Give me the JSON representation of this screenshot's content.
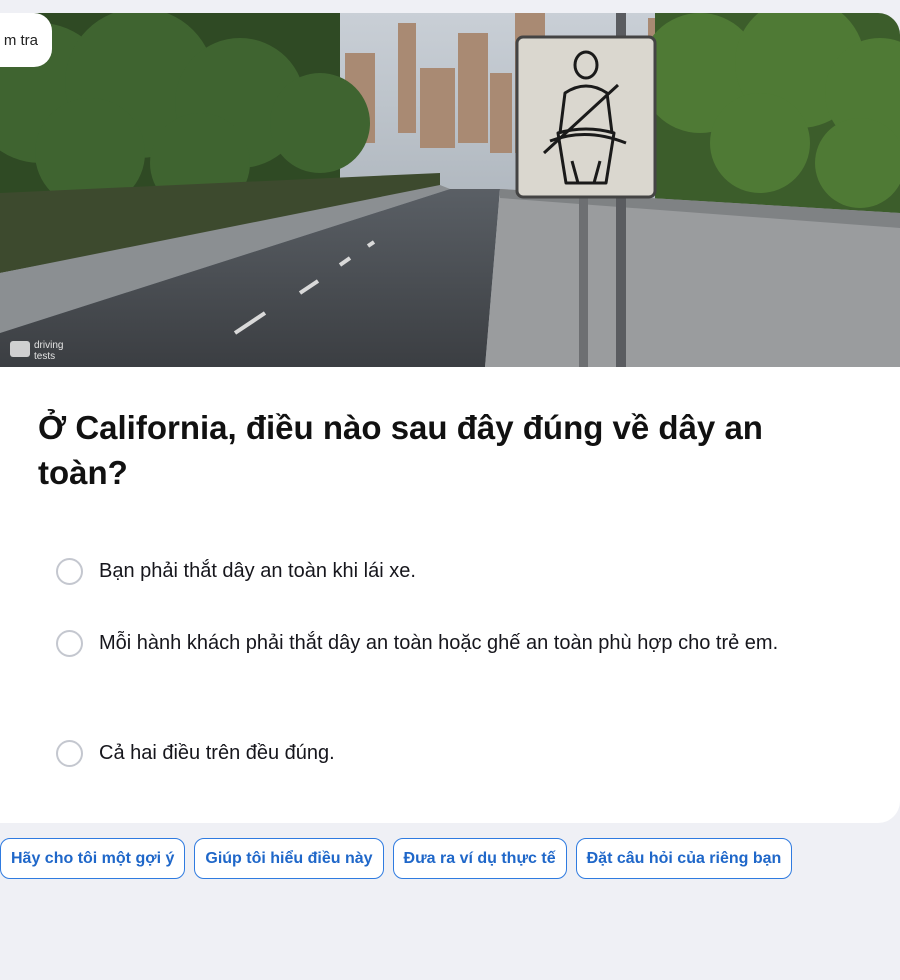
{
  "header": {
    "badge_text": "m tra"
  },
  "hero": {
    "watermark_line1": "driving",
    "watermark_line2": "tests"
  },
  "question": {
    "text": "Ở California, điều nào sau đây đúng về dây an toàn?"
  },
  "options": [
    {
      "label": "Bạn phải thắt dây an toàn khi lái xe."
    },
    {
      "label": "Mỗi hành khách phải thắt dây an toàn hoặc ghế an toàn phù hợp cho trẻ em."
    },
    {
      "label": "Cả hai điều trên đều đúng."
    }
  ],
  "actions": [
    {
      "label": "Hãy cho tôi một gợi ý"
    },
    {
      "label": "Giúp tôi hiểu điều này"
    },
    {
      "label": "Đưa ra ví dụ thực tế"
    },
    {
      "label": "Đặt câu hỏi của riêng bạn"
    }
  ],
  "colors": {
    "accent": "#1f67c9",
    "background": "#eff0f5",
    "radio_border": "#c4c7cf"
  }
}
